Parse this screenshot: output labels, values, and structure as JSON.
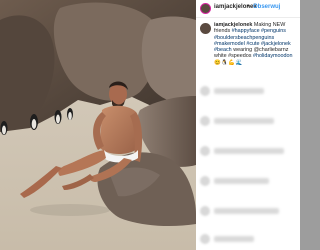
{
  "post": {
    "username": "iamjackjelonek",
    "separator": "•",
    "follow_label": "Obserwuj",
    "caption": {
      "username": "iamjackjelonek",
      "text": "Making NEW friends",
      "tags": "#happyface #penguins #bouldersbeachpenguins #makemodel #cute #jackjelonek #beach",
      "text2": "wearing @charliebarnz white #speedos",
      "tags2": "#holidaymoodon"
    }
  },
  "colors": {
    "link": "#3897f0",
    "hashtag": "#003569",
    "text": "#262626"
  }
}
